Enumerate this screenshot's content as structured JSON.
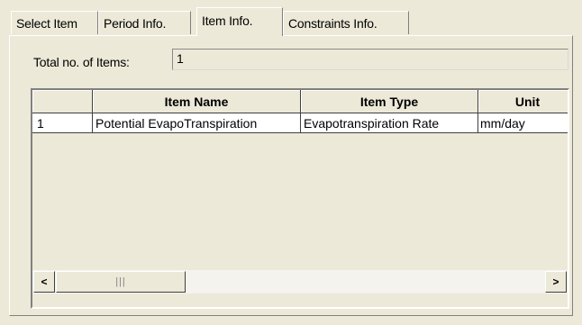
{
  "tabs": [
    {
      "label": "Select Item",
      "active": false
    },
    {
      "label": "Period Info.",
      "active": false
    },
    {
      "label": "Item Info.",
      "active": true
    },
    {
      "label": "Constraints Info.",
      "active": false
    }
  ],
  "total": {
    "label": "Total no. of Items:",
    "value": "1"
  },
  "grid": {
    "columns": [
      "",
      "Item Name",
      "Item Type",
      "Unit"
    ],
    "rows": [
      {
        "index": "1",
        "item_name": "Potential EvapoTranspiration",
        "item_type": "Evapotranspiration Rate",
        "unit": "mm/day"
      }
    ]
  },
  "scrollbar": {
    "left_arrow": "<",
    "right_arrow": ">",
    "thumb_grip": "|||"
  }
}
